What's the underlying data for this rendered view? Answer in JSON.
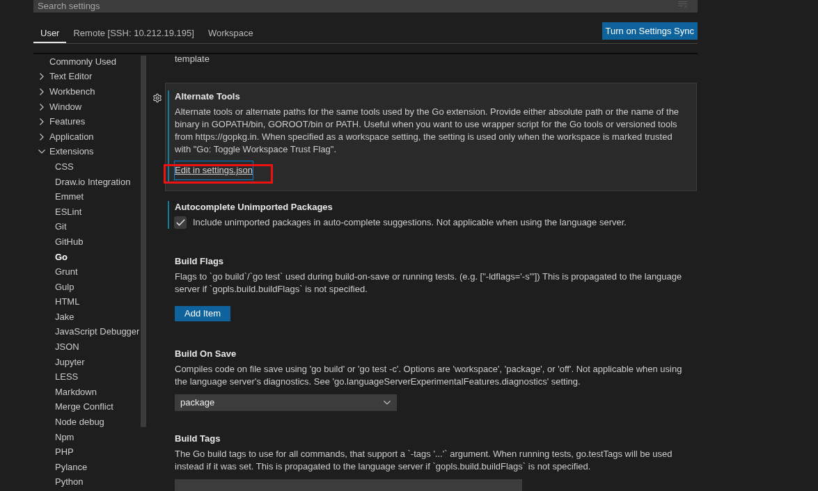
{
  "search": {
    "placeholder": "Search settings"
  },
  "tabs": [
    {
      "label": "User",
      "selected": true
    },
    {
      "label": "Remote [SSH: 10.212.19.195]",
      "selected": false
    },
    {
      "label": "Workspace",
      "selected": false
    }
  ],
  "sync_button": "Turn on Settings Sync",
  "sidebar": {
    "items": [
      {
        "label": "Commonly Used",
        "kind": "page",
        "selected": false
      },
      {
        "label": "Text Editor",
        "kind": "group",
        "expanded": false,
        "selected": false
      },
      {
        "label": "Workbench",
        "kind": "group",
        "expanded": false,
        "selected": false
      },
      {
        "label": "Window",
        "kind": "group",
        "expanded": false,
        "selected": false
      },
      {
        "label": "Features",
        "kind": "group",
        "expanded": false,
        "selected": false
      },
      {
        "label": "Application",
        "kind": "group",
        "expanded": false,
        "selected": false
      },
      {
        "label": "Extensions",
        "kind": "group",
        "expanded": true,
        "selected": false,
        "children": [
          {
            "label": "CSS",
            "selected": false
          },
          {
            "label": "Draw.io Integration",
            "selected": false
          },
          {
            "label": "Emmet",
            "selected": false
          },
          {
            "label": "ESLint",
            "selected": false
          },
          {
            "label": "Git",
            "selected": false
          },
          {
            "label": "GitHub",
            "selected": false
          },
          {
            "label": "Go",
            "selected": true
          },
          {
            "label": "Grunt",
            "selected": false
          },
          {
            "label": "Gulp",
            "selected": false
          },
          {
            "label": "HTML",
            "selected": false
          },
          {
            "label": "Jake",
            "selected": false
          },
          {
            "label": "JavaScript Debugger",
            "selected": false
          },
          {
            "label": "JSON",
            "selected": false
          },
          {
            "label": "Jupyter",
            "selected": false
          },
          {
            "label": "LESS",
            "selected": false
          },
          {
            "label": "Markdown",
            "selected": false
          },
          {
            "label": "Merge Conflict",
            "selected": false
          },
          {
            "label": "Node debug",
            "selected": false
          },
          {
            "label": "Npm",
            "selected": false
          },
          {
            "label": "PHP",
            "selected": false
          },
          {
            "label": "Pylance",
            "selected": false
          },
          {
            "label": "Python",
            "selected": false
          }
        ]
      }
    ]
  },
  "content": {
    "cut_text": "template",
    "settings": [
      {
        "kind": "json_link",
        "title": "Alternate Tools",
        "description": "Alternate tools or alternate paths for the same tools used by the Go extension. Provide either absolute path or the name of the binary in GOPATH/bin, GOROOT/bin or PATH. Useful when you want to use wrapper script for the Go tools or versioned tools from https://gopkg.in. When specified as a workspace setting, the setting is used only when the workspace is marked trusted with \"Go: Toggle Workspace Trust Flag\".",
        "link": "Edit in settings.json",
        "focused": true,
        "modified": true,
        "link_focused": true,
        "annotated": true
      },
      {
        "kind": "checkbox",
        "title": "Autocomplete Unimported Packages",
        "description": "Include unimported packages in auto-complete suggestions. Not applicable when using the language server.",
        "checked": true,
        "focused": false,
        "modified": true
      },
      {
        "kind": "array",
        "title": "Build Flags",
        "description": "Flags to `go build`/`go test` used during build-on-save or running tests. (e.g. [\"-ldflags='-s'\"]) This is propagated to the language server if `gopls.build.buildFlags` is not specified.",
        "button": "Add Item",
        "focused": false,
        "modified": false
      },
      {
        "kind": "select",
        "title": "Build On Save",
        "description": "Compiles code on file save using 'go build' or 'go test -c'. Options are 'workspace', 'package', or 'off'. Not applicable when using the language server's diagnostics. See 'go.languageServerExperimentalFeatures.diagnostics' setting.",
        "value": "package",
        "focused": false,
        "modified": false
      },
      {
        "kind": "text",
        "title": "Build Tags",
        "description": "The Go build tags to use for all commands, that support a `-tags '...'` argument. When running tests, go.testTags will be used instead if it was set. This is propagated to the language server if `gopls.build.buildFlags` is not specified.",
        "focused": false,
        "modified": false
      }
    ]
  }
}
